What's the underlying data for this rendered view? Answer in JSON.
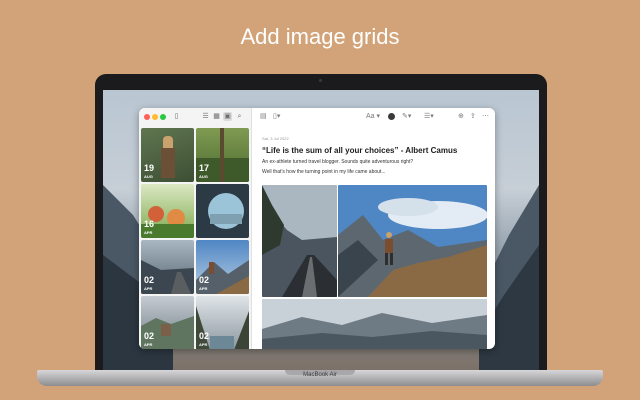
{
  "headline": "Add image grids",
  "laptop_label": "MacBook Air",
  "sidebar": {
    "toolbar_icons": [
      "sidebar-icon",
      "list-icon",
      "grid-small-icon",
      "grid-large-icon",
      "search-icon"
    ],
    "tiles": [
      {
        "day": "19",
        "month": "AUG"
      },
      {
        "day": "17",
        "month": "AUG"
      },
      {
        "day": "16",
        "month": "APR"
      },
      {
        "day": "",
        "month": ""
      },
      {
        "day": "02",
        "month": "APR"
      },
      {
        "day": "02",
        "month": "APR"
      },
      {
        "day": "02",
        "month": "APR"
      },
      {
        "day": "02",
        "month": "APR"
      }
    ]
  },
  "editor": {
    "toolbar": {
      "format_label": "Aa",
      "icons": [
        "note-icon",
        "attachment-icon",
        "text-format-icon",
        "color-circle-icon",
        "pen-icon",
        "list-icon",
        "add-icon",
        "share-icon",
        "more-icon"
      ]
    },
    "date": "Sat, 3 Jul 2022",
    "title": "“Life is the sum of all your choices” - Albert Camus",
    "paragraph1": "An ex-athlete turned travel blogger. Sounds quite adventurous right?",
    "paragraph2": "Well that’s how the turning point in my life came about..."
  }
}
